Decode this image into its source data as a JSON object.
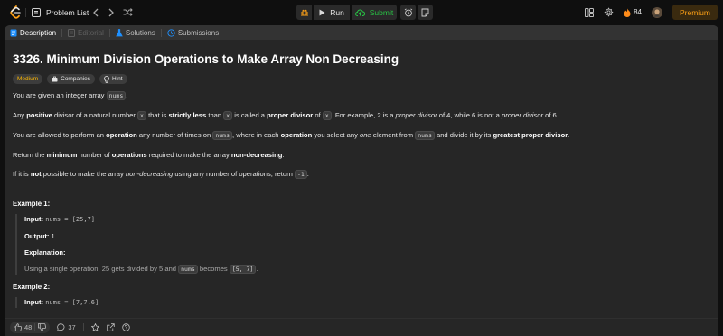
{
  "topbar": {
    "problem_list_label": "Problem List",
    "run_label": "Run",
    "submit_label": "Submit",
    "streak_count": "84",
    "premium_label": "Premium"
  },
  "tabs": [
    {
      "label": "Description",
      "state": "active"
    },
    {
      "label": "Editorial",
      "state": "disabled"
    },
    {
      "label": "Solutions",
      "state": "normal"
    },
    {
      "label": "Submissions",
      "state": "normal"
    }
  ],
  "problem": {
    "title": "3326. Minimum Division Operations to Make Array Non Decreasing",
    "badges": {
      "difficulty": "Medium",
      "companies": "Companies",
      "hint": "Hint"
    },
    "p1": {
      "a": "You are given an integer array ",
      "code": "nums",
      "b": "."
    },
    "p2": {
      "a": "Any ",
      "b1": "positive",
      "c": " divisor of a natural number ",
      "code1": "x",
      "d": " that is ",
      "b2": "strictly less",
      "e": " than ",
      "code2": "x",
      "f": " is called a ",
      "b3": "proper divisor",
      "g": " of ",
      "code3": "x",
      "h": ". For example, 2 is a ",
      "i1": "proper divisor",
      "j": " of 4, while 6 is not a ",
      "i2": "proper divisor",
      "k": " of 6."
    },
    "p3": {
      "a": "You are allowed to perform an ",
      "b1": "operation",
      "c": " any number of times on ",
      "code1": "nums",
      "d": ", where in each ",
      "b2": "operation",
      "e": " you select any ",
      "i1": "one",
      "f": " element from ",
      "code2": "nums",
      "g": " and divide it by its ",
      "b3": "greatest proper divisor",
      "h": "."
    },
    "p4": {
      "a": "Return the ",
      "b1": "minimum",
      "c": " number of ",
      "b2": "operations",
      "d": " required to make the array ",
      "b3": "non-decreasing",
      "e": "."
    },
    "p5": {
      "a": "If it is ",
      "b1": "not",
      "c": " possible to make the array ",
      "i1": "non-decreasing",
      "d": " using any number of operations, return ",
      "code1": "-1",
      "e": "."
    },
    "example1": {
      "heading": "Example 1:",
      "input_label": "Input:",
      "input_value": "nums = [25,7]",
      "output_label": "Output:",
      "output_value": "1",
      "explanation_label": "Explanation:",
      "explanation": {
        "a": "Using a single operation, 25 gets divided by 5 and ",
        "code1": "nums",
        "b": " becomes ",
        "code2": "[5, 7]",
        "c": "."
      }
    },
    "example2": {
      "heading": "Example 2:",
      "input_label": "Input:",
      "input_value": "nums = [7,7,6]"
    }
  },
  "bottombar": {
    "likes": "48",
    "comments": "37"
  }
}
